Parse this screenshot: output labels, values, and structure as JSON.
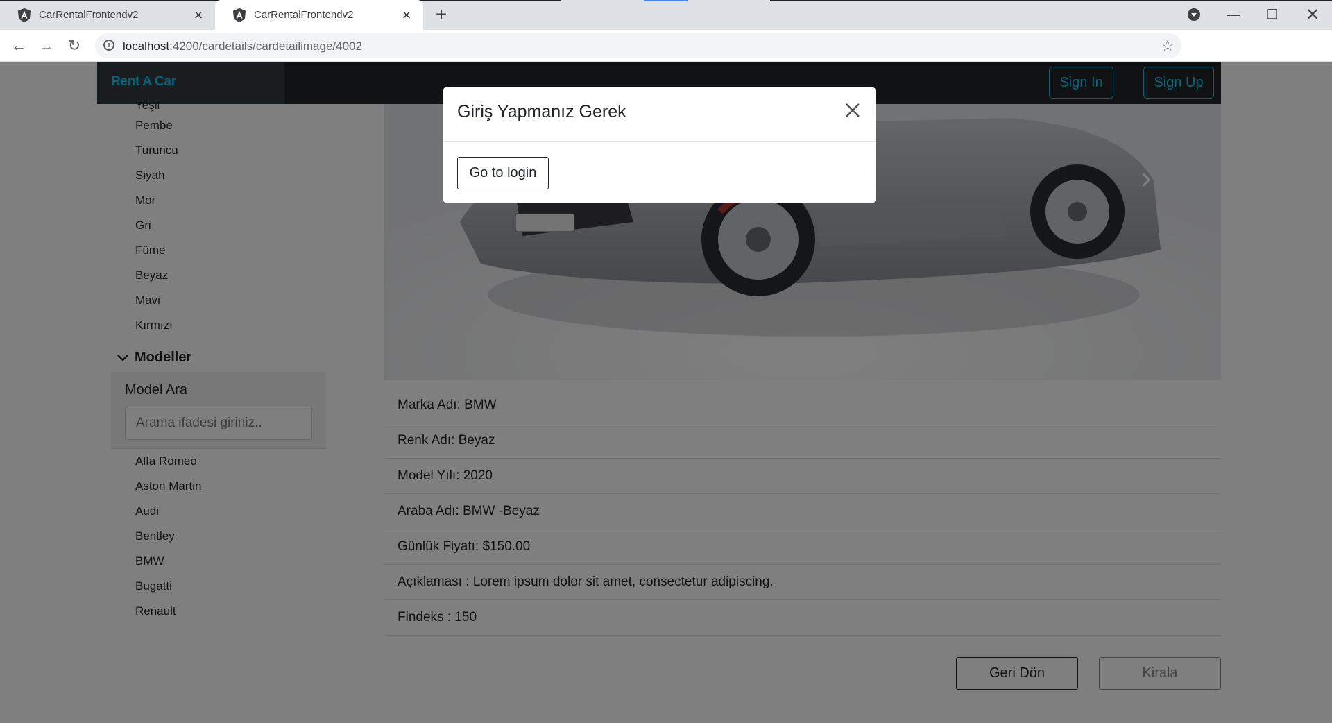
{
  "browser": {
    "tabs": [
      {
        "title": "CarRentalFrontendv2",
        "active": false
      },
      {
        "title": "CarRentalFrontendv2",
        "active": true
      }
    ],
    "url_host": "localhost",
    "url_rest": ":4200/cardetails/cardetailimage/4002"
  },
  "navbar": {
    "brand": "Rent A Car",
    "sign_in": "Sign In",
    "sign_up": "Sign Up"
  },
  "sidebar": {
    "colors_partial_item": "Yeşil",
    "colors": [
      "Pembe",
      "Turuncu",
      "Siyah",
      "Mor",
      "Gri",
      "Füme",
      "Beyaz",
      "Mavi",
      "Kırmızı"
    ],
    "models_header": "Modeller",
    "models_search_label": "Model Ara",
    "models_search_placeholder": "Arama ifadesi giriniz..",
    "models": [
      "Alfa Romeo",
      "Aston Martin",
      "Audi",
      "Bentley",
      "BMW",
      "Bugatti",
      "Renault"
    ]
  },
  "details": [
    "Marka Adı: BMW",
    "Renk Adı: Beyaz",
    "Model Yılı: 2020",
    "Araba Adı: BMW -Beyaz",
    "Günlük Fiyatı: $150.00",
    "Açıklaması : Lorem ipsum dolor sit amet, consectetur adipiscing.",
    "Findeks : 150"
  ],
  "actions": {
    "back": "Geri Dön",
    "rent": "Kirala"
  },
  "modal": {
    "title": "Giriş Yapmanız Gerek",
    "button": "Go to login"
  },
  "colors": {
    "accent": "#0dcaf0",
    "navbar": "#212529",
    "brand_box": "#343a40"
  }
}
